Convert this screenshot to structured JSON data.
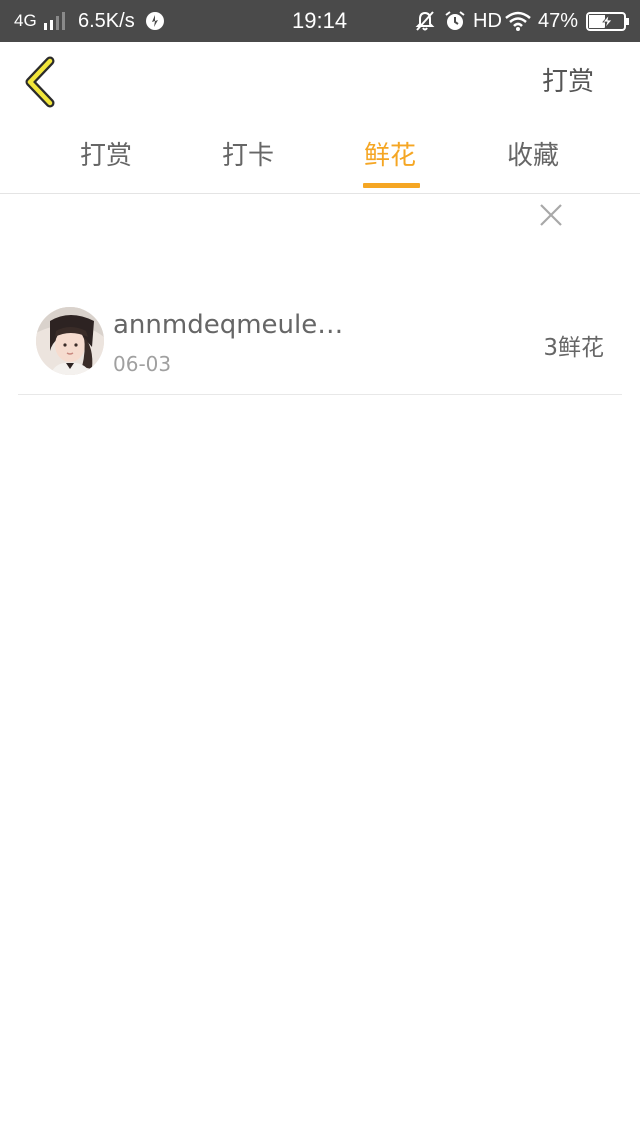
{
  "status_bar": {
    "network": "4G",
    "speed": "6.5K/s",
    "time": "19:14",
    "hd": "HD",
    "battery": "47%"
  },
  "nav": {
    "action_label": "打赏"
  },
  "tabs": [
    {
      "label": "打赏"
    },
    {
      "label": "打卡"
    },
    {
      "label": "鲜花"
    },
    {
      "label": "收藏"
    }
  ],
  "active_tab": "鲜花",
  "colors": {
    "accent": "#f5a623",
    "status_bar_bg": "#4a4a4a",
    "text": "#666666",
    "subtext": "#a0a0a0"
  },
  "records": [
    {
      "name": "annmdeqmeule…",
      "date": "06-03",
      "count": "3鲜花"
    }
  ]
}
